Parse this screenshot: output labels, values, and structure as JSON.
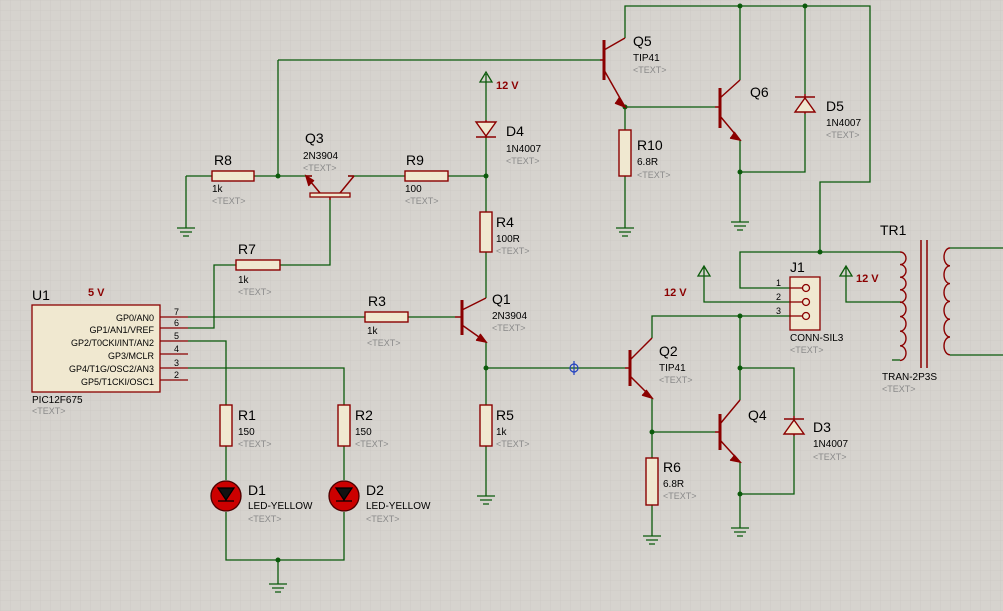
{
  "components": {
    "u1": {
      "ref": "U1",
      "value": "PIC12F675",
      "text": "<TEXT>",
      "supply": "5 V",
      "pins_left": [
        "GP0/AN0",
        "GP1/AN1/VREF",
        "GP2/T0CKI/INT/AN2",
        "GP3/MCLR",
        "GP4/T1G/OSC2/AN3",
        "GP5/T1CKI/OSC1"
      ],
      "pin_numbers": [
        "7",
        "6",
        "5",
        "4",
        "3",
        "2"
      ]
    },
    "r1": {
      "ref": "R1",
      "value": "150",
      "text": "<TEXT>"
    },
    "r2": {
      "ref": "R2",
      "value": "150",
      "text": "<TEXT>"
    },
    "r3": {
      "ref": "R3",
      "value": "1k",
      "text": "<TEXT>"
    },
    "r4": {
      "ref": "R4",
      "value": "100R",
      "text": "<TEXT>"
    },
    "r5": {
      "ref": "R5",
      "value": "1k",
      "text": "<TEXT>"
    },
    "r6": {
      "ref": "R6",
      "value": "6.8R",
      "text": "<TEXT>"
    },
    "r7": {
      "ref": "R7",
      "value": "1k",
      "text": "<TEXT>"
    },
    "r8": {
      "ref": "R8",
      "value": "1k",
      "text": "<TEXT>"
    },
    "r9": {
      "ref": "R9",
      "value": "100",
      "text": "<TEXT>"
    },
    "r10": {
      "ref": "R10",
      "value": "6.8R",
      "text": "<TEXT>"
    },
    "d1": {
      "ref": "D1",
      "value": "LED-YELLOW",
      "text": "<TEXT>"
    },
    "d2": {
      "ref": "D2",
      "value": "LED-YELLOW",
      "text": "<TEXT>"
    },
    "d3": {
      "ref": "D3",
      "value": "1N4007",
      "text": "<TEXT>"
    },
    "d4": {
      "ref": "D4",
      "value": "1N4007",
      "text": "<TEXT>"
    },
    "d5": {
      "ref": "D5",
      "value": "1N4007",
      "text": "<TEXT>"
    },
    "q1": {
      "ref": "Q1",
      "value": "2N3904",
      "text": "<TEXT>"
    },
    "q2": {
      "ref": "Q2",
      "value": "TIP41",
      "text": "<TEXT>"
    },
    "q3": {
      "ref": "Q3",
      "value": "2N3904",
      "text": "<TEXT>"
    },
    "q4": {
      "ref": "Q4",
      "value": "",
      "text": ""
    },
    "q5": {
      "ref": "Q5",
      "value": "TIP41",
      "text": "<TEXT>"
    },
    "q6": {
      "ref": "Q6",
      "value": "",
      "text": ""
    },
    "j1": {
      "ref": "J1",
      "value": "CONN-SIL3",
      "text": "<TEXT>",
      "pins": [
        "1",
        "2",
        "3"
      ]
    },
    "tr1": {
      "ref": "TR1",
      "value": "TRAN-2P3S",
      "text": "<TEXT>"
    }
  },
  "supplies": {
    "v12_top": "12 V",
    "v12_mid": "12 V",
    "v12_right": "12 V"
  },
  "colors": {
    "wire": "#0b5a0b",
    "component": "#8b0000",
    "led_fill": "#cc0000",
    "background": "#d6d3ce",
    "chip_fill": "#f0e8d0"
  }
}
